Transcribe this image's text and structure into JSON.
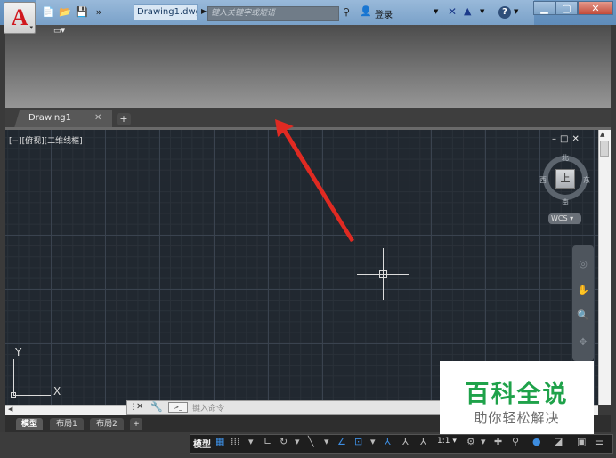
{
  "titlebar": {
    "file_title": "Drawing1.dwg",
    "search_placeholder": "键入关键字或短语",
    "login_label": "登录",
    "win_min": "▁",
    "win_max": "▢",
    "win_close": "✕"
  },
  "quick_access": {
    "new_icon": "📄",
    "open_icon": "📂",
    "save_icon": "💾",
    "more_icon": "»"
  },
  "ribbon": {
    "dropdown_icon": "▭▾"
  },
  "file_tabs": {
    "active_label": "Drawing1",
    "close_glyph": "✕",
    "add_glyph": "+"
  },
  "viewport": {
    "label": "[−][俯视][二维线框]",
    "controls": "–□✕"
  },
  "viewcube": {
    "face": "上",
    "north": "北",
    "south": "南",
    "west": "西",
    "east": "东",
    "wcs": "WCS ▾"
  },
  "ucs": {
    "x_label": "X",
    "y_label": "Y"
  },
  "command_line": {
    "placeholder": "键入命令",
    "prompt_glyph": ">_",
    "close_glyph": "✕",
    "wrench_glyph": "🔧"
  },
  "layout_tabs": {
    "model": "模型",
    "layout1": "布局1",
    "layout2": "布局2",
    "add": "+"
  },
  "statusbar": {
    "model": "模型",
    "scale": "1:1 ▾"
  },
  "watermark": {
    "title": "百科全说",
    "subtitle": "助你轻松解决"
  },
  "colors": {
    "viewport_bg": "#212830",
    "titlebar_blue": "#6e9ac6",
    "annotation_arrow": "#e02a22",
    "watermark_green": "#1fa24a"
  }
}
